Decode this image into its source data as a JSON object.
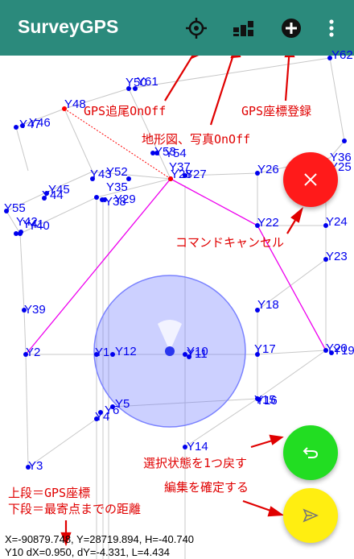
{
  "appbar": {
    "title": "SurveyGPS",
    "color": "#2b8a7c",
    "buttons": [
      {
        "icon": "gps-target-icon"
      },
      {
        "icon": "terrain-photo-icon"
      },
      {
        "icon": "add-circle-icon"
      },
      {
        "icon": "more-vert-icon"
      }
    ]
  },
  "points": [
    {
      "label": "Y62"
    },
    {
      "label": "Y50"
    },
    {
      "label": "Y61"
    },
    {
      "label": "Y48"
    },
    {
      "label": "Y47"
    },
    {
      "label": "Y46"
    },
    {
      "label": "Y53"
    },
    {
      "label": "Y52"
    },
    {
      "label": "Y54"
    },
    {
      "label": "Y37"
    },
    {
      "label": "Y28"
    },
    {
      "label": "Y27"
    },
    {
      "label": "Y26"
    },
    {
      "label": "Y36"
    },
    {
      "label": "Y25"
    },
    {
      "label": "Y45"
    },
    {
      "label": "Y44"
    },
    {
      "label": "Y43"
    },
    {
      "label": "Y42"
    },
    {
      "label": "Y35"
    },
    {
      "label": "Y29"
    },
    {
      "label": "Y38"
    },
    {
      "label": "Y55"
    },
    {
      "label": "Y41"
    },
    {
      "label": "Y40"
    },
    {
      "label": "Y22"
    },
    {
      "label": "Y24"
    },
    {
      "label": "Y23"
    },
    {
      "label": "Y18"
    },
    {
      "label": "Y39"
    },
    {
      "label": "Y2"
    },
    {
      "label": "Y1"
    },
    {
      "label": "Y12"
    },
    {
      "label": "Y10"
    },
    {
      "label": "Y11"
    },
    {
      "label": "Y17"
    },
    {
      "label": "Y20"
    },
    {
      "label": "Y19"
    },
    {
      "label": "Y15"
    },
    {
      "label": "Y16"
    },
    {
      "label": "Y5"
    },
    {
      "label": "Y6"
    },
    {
      "label": "Y4"
    },
    {
      "label": "Y14"
    },
    {
      "label": "Y3"
    }
  ],
  "annotations": {
    "gps_follow": "GPS追尾OnOff",
    "gps_register": "GPS座標登録",
    "terrain_photo": "地形図、写真OnOff",
    "command_cancel": "コマンドキャンセル",
    "undo_selection": "選択状態を1つ戻す",
    "confirm_edit": "編集を確定する",
    "upper_line": "上段＝GPS座標",
    "lower_line": "下段＝最寄点までの距離",
    "color": "#e00000"
  },
  "fabs": {
    "cancel": {
      "icon": "close-icon",
      "color": "#ff1a1a"
    },
    "undo": {
      "icon": "undo-icon",
      "color": "#22dd22"
    },
    "confirm": {
      "icon": "send-icon",
      "color": "#ffee11"
    }
  },
  "status": {
    "line1": "X=-90879.748, Y=28719.894, H=-40.740",
    "line2": "Y10 dX=0.950, dY=-4.331, L=4.434"
  }
}
